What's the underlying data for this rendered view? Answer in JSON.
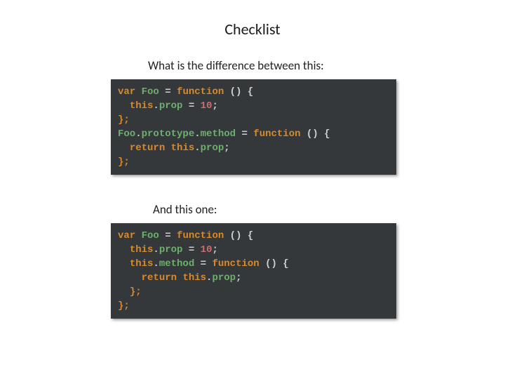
{
  "title": "Checklist",
  "q1": "What is the difference between this:",
  "q2": "And this one:",
  "code1": {
    "l1_var": "var",
    "l1_foo": " Foo ",
    "l1_eq": "= ",
    "l1_fn": "function",
    "l1_rest": " () {",
    "l2_indent": "  ",
    "l2_this": "this",
    "l2_dot": ".",
    "l2_prop": "prop",
    "l2_eq": " = ",
    "l2_num": "10",
    "l2_semi": ";",
    "l3_close": "};",
    "l4_foo": "Foo",
    "l4_dot1": ".",
    "l4_proto": "prototype",
    "l4_dot2": ".",
    "l4_method": "method",
    "l4_eq": " = ",
    "l4_fn": "function",
    "l4_rest": " () {",
    "l5_indent": "  ",
    "l5_return": "return",
    "l5_sp": " ",
    "l5_this": "this",
    "l5_dot": ".",
    "l5_prop": "prop",
    "l5_semi": ";",
    "l6_close": "};"
  },
  "code2": {
    "l1_var": "var",
    "l1_foo": " Foo ",
    "l1_eq": "= ",
    "l1_fn": "function",
    "l1_rest": " () {",
    "l2_indent": "  ",
    "l2_this": "this",
    "l2_dot": ".",
    "l2_prop": "prop",
    "l2_eq": " = ",
    "l2_num": "10",
    "l2_semi": ";",
    "l3_indent": "  ",
    "l3_this": "this",
    "l3_dot": ".",
    "l3_method": "method",
    "l3_eq": " = ",
    "l3_fn": "function",
    "l3_rest": " () {",
    "l4_indent": "    ",
    "l4_return": "return",
    "l4_sp": " ",
    "l4_this": "this",
    "l4_dot": ".",
    "l4_prop": "prop",
    "l4_semi": ";",
    "l5_indent": "  ",
    "l5_close": "};",
    "l6_close": "};"
  }
}
